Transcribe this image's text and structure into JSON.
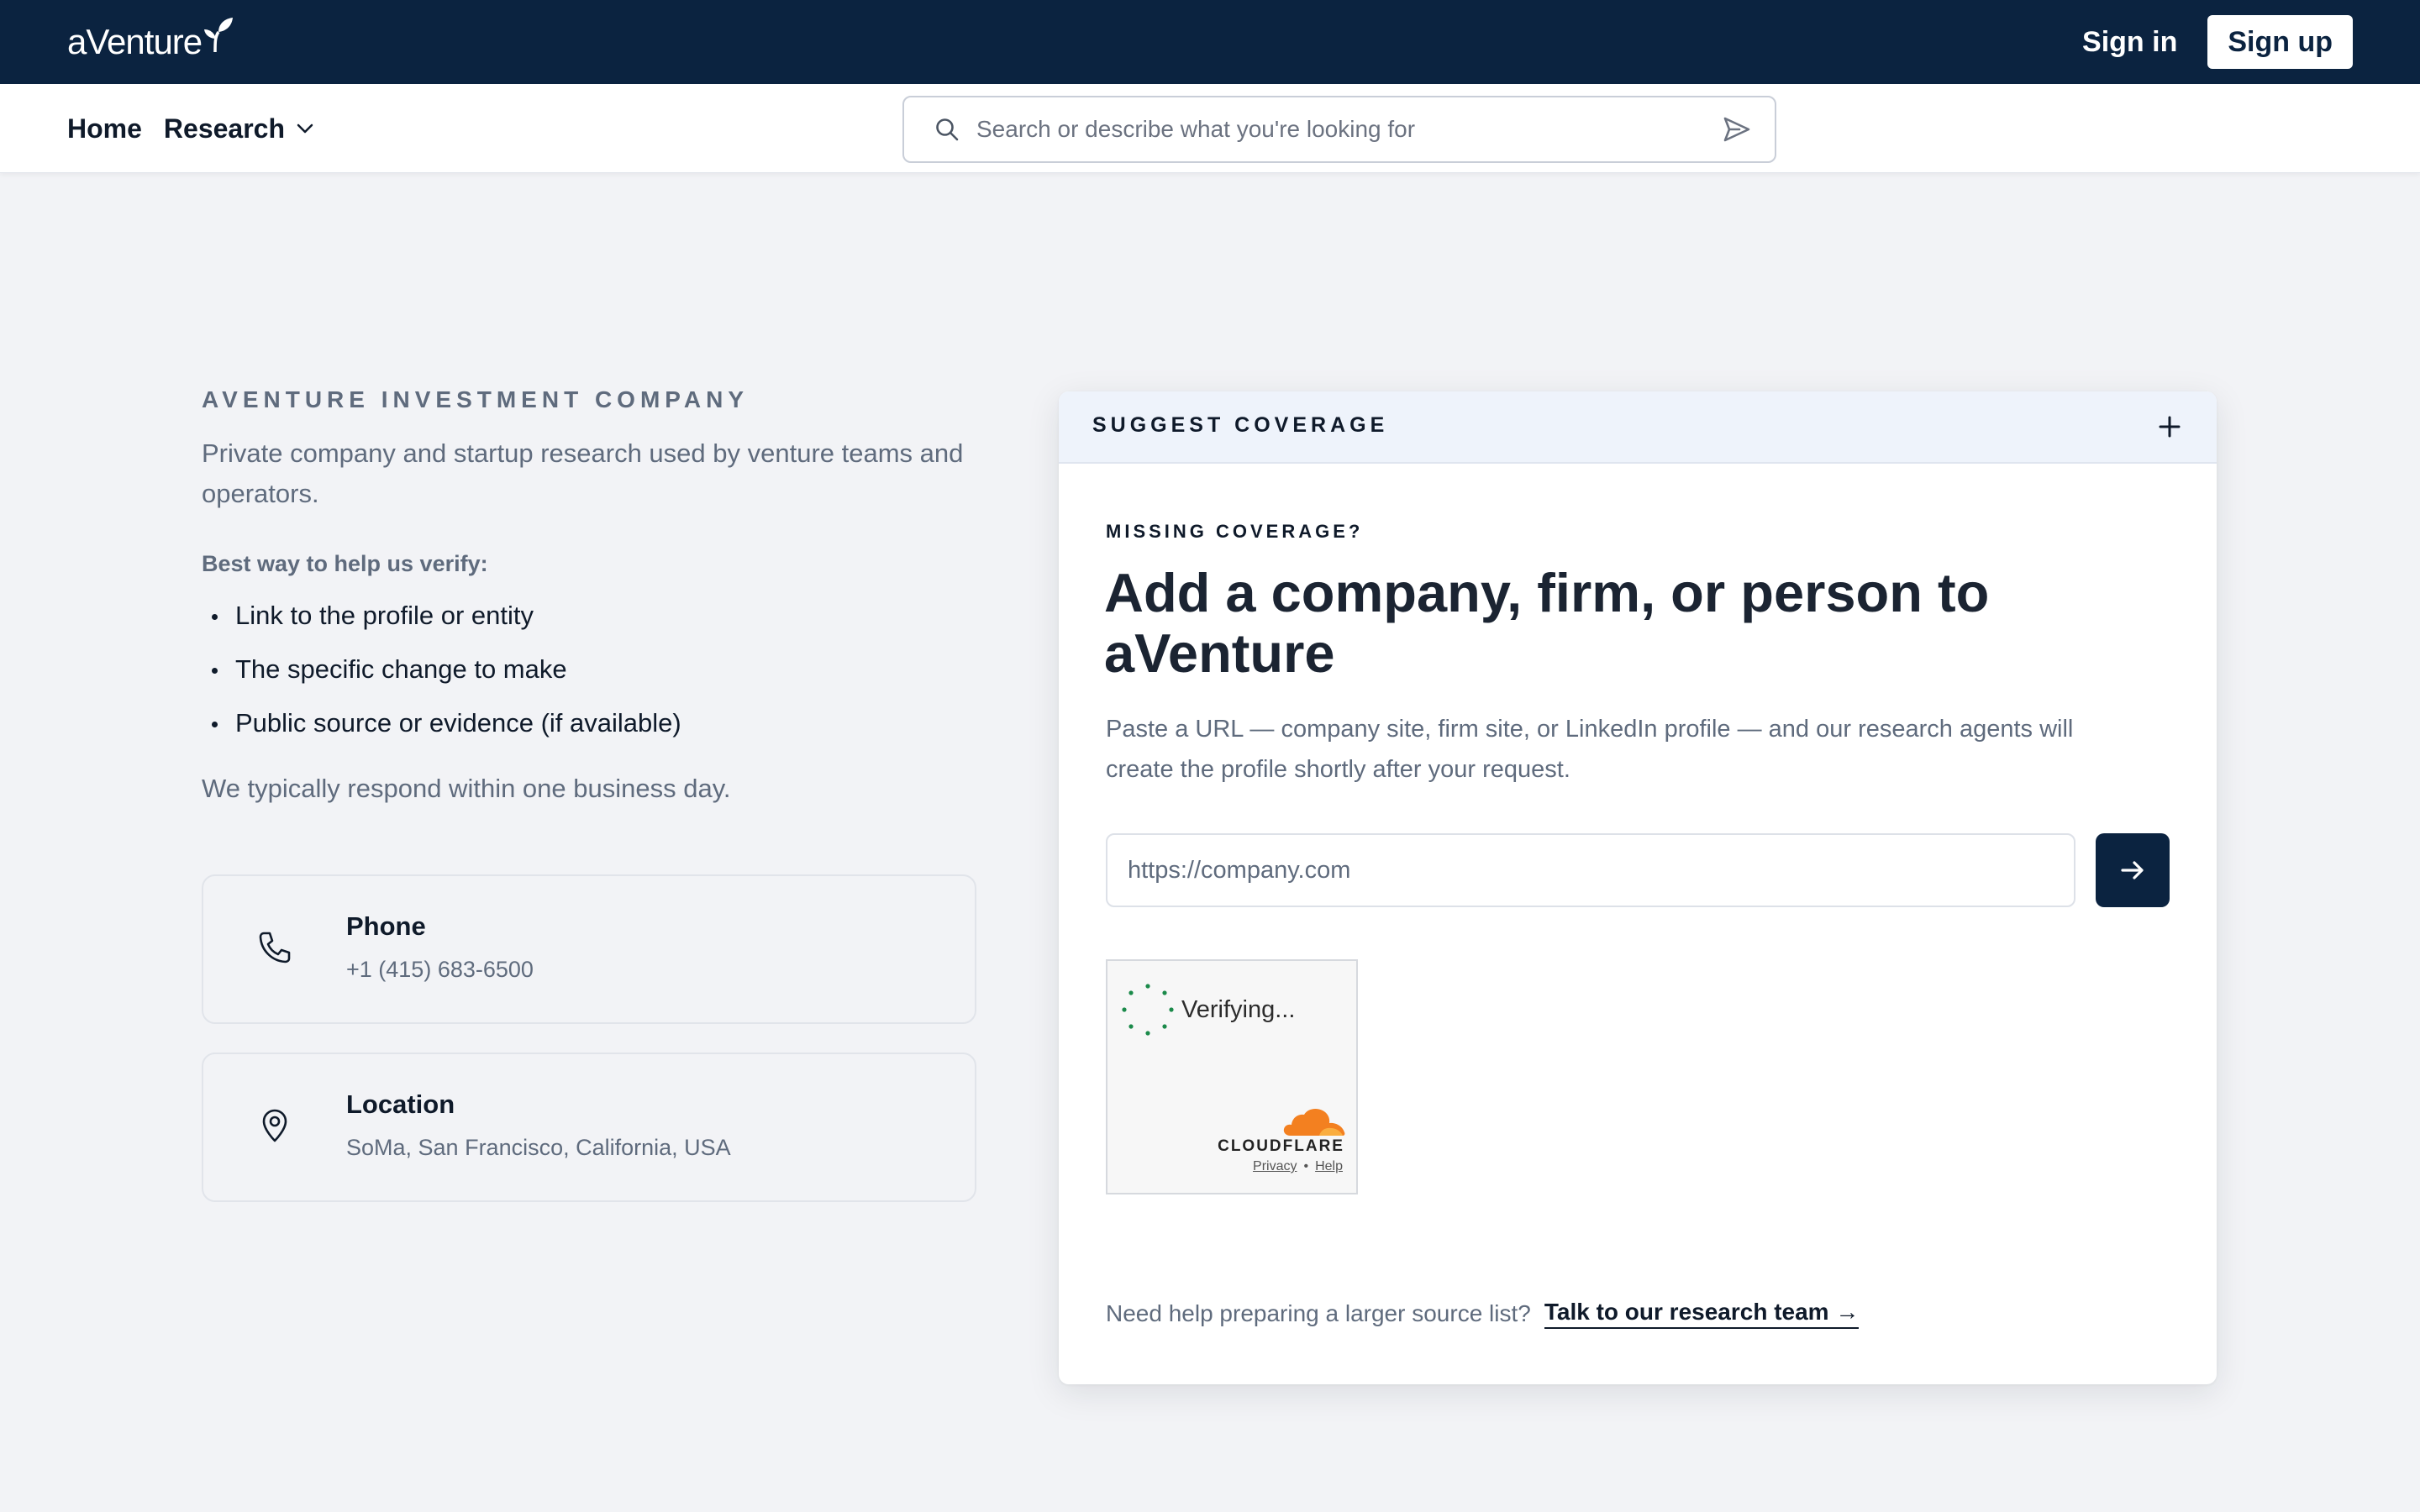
{
  "brand": {
    "logo_text": "aVenture"
  },
  "header": {
    "sign_in": "Sign in",
    "sign_up": "Sign up"
  },
  "nav": {
    "home": "Home",
    "research": "Research"
  },
  "search": {
    "placeholder": "Search or describe what you're looking for"
  },
  "info": {
    "eyebrow": "AVENTURE INVESTMENT COMPANY",
    "tagline": "Private company and startup research used by venture teams and operators.",
    "verify_label": "Best way to help us verify:",
    "bullets": [
      "Link to the profile or entity",
      "The specific change to make",
      "Public source or evidence (if available)"
    ],
    "response_note": "We typically respond within one business day."
  },
  "contact": {
    "phone": {
      "label": "Phone",
      "value": "+1 (415) 683-6500"
    },
    "location": {
      "label": "Location",
      "value": "SoMa, San Francisco, California, USA"
    }
  },
  "panel": {
    "header_title": "SUGGEST COVERAGE",
    "eyebrow": "MISSING COVERAGE?",
    "headline": "Add a company, firm, or person to aVenture",
    "description": "Paste a URL — company site, firm site, or LinkedIn profile — and our research agents will create the profile shortly after your request.",
    "url_placeholder": "https://company.com",
    "captcha": {
      "status": "Verifying...",
      "brand": "CLOUDFLARE",
      "privacy": "Privacy",
      "separator": "•",
      "help": "Help"
    },
    "help_text": "Need help preparing a larger source list?",
    "help_link": "Talk to our research team →"
  },
  "colors": {
    "navy": "#0b2340",
    "page_bg": "#f2f3f6",
    "muted_text": "#5f6b7d",
    "cloudflare_orange": "#f38020"
  }
}
